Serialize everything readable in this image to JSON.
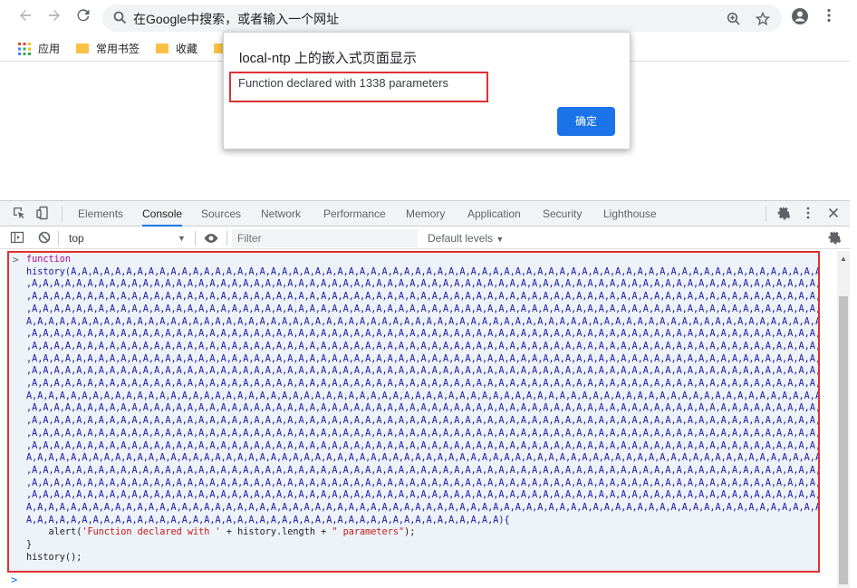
{
  "browser": {
    "omnibox_placeholder": "在Google中搜索，或者输入一个网址",
    "bookmarks": [
      {
        "label": "应用"
      },
      {
        "label": "常用书签"
      },
      {
        "label": "收藏"
      }
    ]
  },
  "dialog": {
    "title": "local-ntp 上的嵌入式页面显示",
    "message": "Function declared with 1338 parameters",
    "ok_label": "确定"
  },
  "devtools": {
    "tabs": [
      "Elements",
      "Console",
      "Sources",
      "Network",
      "Performance",
      "Memory",
      "Application",
      "Security",
      "Lighthouse"
    ],
    "active_tab": "Console",
    "context": "top",
    "filter_placeholder": "Filter",
    "levels_label": "Default levels"
  },
  "console": {
    "keyword": "function",
    "signature_start": "history(A,A,A,A,A,A,A,A,A,A,A,A,A,A,A,A,A,A,A,A,A,A,A,A,A,A,A,A,A,A,A,A,A,A,A,A,A,A,A,A,A,A,A,A,A,A,A,A,A,A,A,A,A,A,A,A,A,A,A,A,A,A,A,A,A,A,A,A,A,A,A,A,A,A,A,A,A,A,A,A,A",
    "param_line_a": ",A,A,A,A,A,A,A,A,A,A,A,A,A,A,A,A,A,A,A,A,A,A,A,A,A,A,A,A,A,A,A,A,A,A,A,A,A,A,A,A,A,A,A,A,A,A,A,A,A,A,A,A,A,A,A,A,A,A,A,A,A,A,A,A,A,A,A,A,A,A,A,A,A,A,A,A,A,A,A,A,A,",
    "param_line_b": "A,A,A,A,A,A,A,A,A,A,A,A,A,A,A,A,A,A,A,A,A,A,A,A,A,A,A,A,A,A,A,A,A,A,A,A,A,A,A,A,A,A,A,A,A,A,A,A,A,A,A,A,A,A,A,A,A,A,A,A,A,A,A,A,A,A,A,A,A,A,A,A,A,A,A,A,A,A,A,A,A,A",
    "signature_end": "A,A,A,A,A,A,A,A,A,A,A,A,A,A,A,A,A,A,A,A,A,A,A,A,A,A,A,A,A,A,A,A,A,A,A,A,A,A,A,A,A,A,A){",
    "body_alert_prefix": "    alert(",
    "body_alert_str1": "'Function declared with '",
    "body_alert_mid": " + history.length + ",
    "body_alert_str2": "\" parameters\"",
    "body_alert_suffix": ");",
    "close_brace": "}",
    "call": "history();"
  }
}
